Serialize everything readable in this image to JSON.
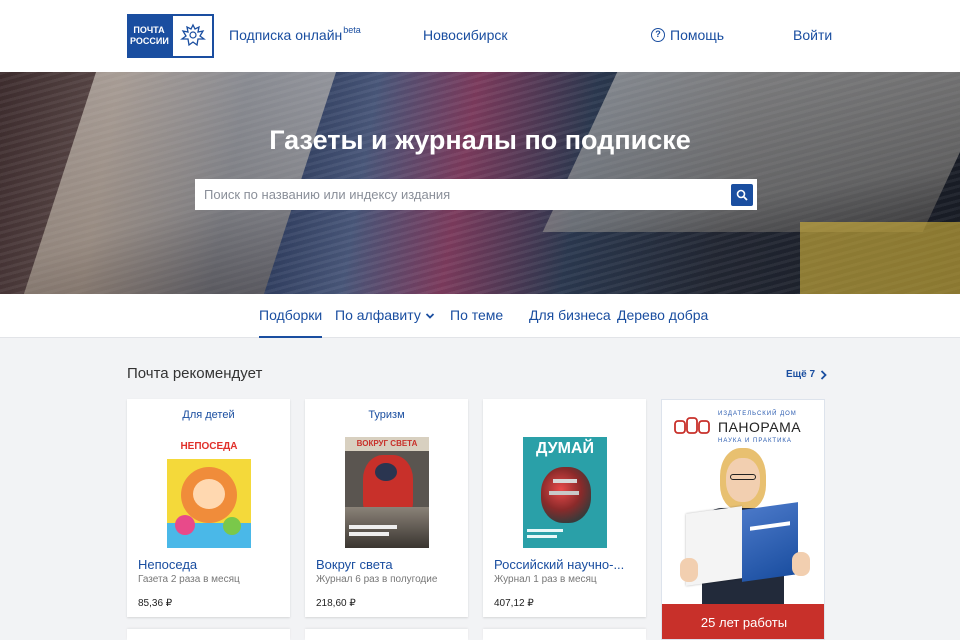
{
  "header": {
    "logo": {
      "line1": "ПОЧТА",
      "line2": "РОССИИ"
    },
    "subscription_link": "Подписка онлайн",
    "beta_badge": "beta",
    "city": "Новосибирск",
    "help": "Помощь",
    "login": "Войти",
    "brand_color": "#1a4ea0"
  },
  "hero": {
    "title": "Газеты и журналы по подписке",
    "search_placeholder": "Поиск по названию или индексу издания",
    "search_icon": "search-icon"
  },
  "tabs": [
    {
      "label": "Подборки",
      "active": true
    },
    {
      "label": "По алфавиту",
      "has_dropdown": true
    },
    {
      "label": "По теме"
    },
    {
      "label": "Для бизнеса"
    },
    {
      "label": "Дерево добра"
    }
  ],
  "recommend": {
    "title": "Почта рекомендует",
    "more": "Ещё 7",
    "cards": [
      {
        "category": "Для детей",
        "name": "Непоседа",
        "frequency": "Газета 2 раза в месяц",
        "price": "85,36 ₽",
        "cover_title": "НЕПОСЕДА"
      },
      {
        "category": "Туризм",
        "name": "Вокруг света",
        "frequency": "Журнал 6 раз в полугодие",
        "price": "218,60 ₽",
        "cover_title": "ВОКРУГ СВЕТА"
      },
      {
        "category": "",
        "name": "Российский научно-...",
        "frequency": "Журнал 1 раз в месяц",
        "price": "407,12 ₽",
        "cover_title": "ДУМАЙ"
      }
    ]
  },
  "ad": {
    "publisher": "ИЗДАТЕЛЬСКИЙ ДОМ",
    "name": "ПАНОРАМА",
    "subtitle": "НАУКА И ПРАКТИКА",
    "banner": "25 лет работы",
    "accent_color": "#c8302a"
  }
}
